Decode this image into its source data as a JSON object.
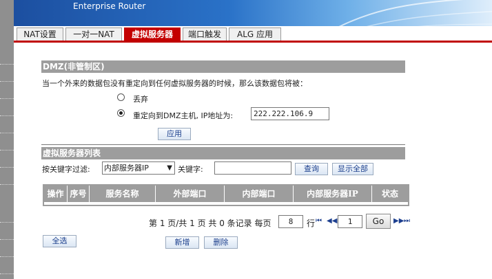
{
  "header": {
    "app_title": "Enterprise Router"
  },
  "tabs": [
    {
      "label": "NAT设置"
    },
    {
      "label": "一对一NAT"
    },
    {
      "label": "虚拟服务器"
    },
    {
      "label": "端口触发"
    },
    {
      "label": "ALG 应用"
    }
  ],
  "dmz": {
    "section_title": "DMZ(非管制区)",
    "description": "当一个外来的数据包没有重定向到任何虚拟服务器的时候，那么该数据包将被：",
    "option_drop": "丢弃",
    "option_redirect": "重定向到DMZ主机, IP地址为:",
    "ip_value": "222.222.106.9",
    "apply_label": "应用"
  },
  "vs_list": {
    "section_title": "虚拟服务器列表",
    "filter_label": "按关键字过滤:",
    "filter_select": "内部服务器IP",
    "keyword_label": "关键字:",
    "keyword_value": "",
    "query_label": "查询",
    "show_all_label": "显示全部",
    "columns": [
      "操作",
      "序号",
      "服务名称",
      "外部端口",
      "内部端口",
      "内部服务器IP",
      "状态"
    ]
  },
  "pager": {
    "summary": "第 1 页/共 1 页 共 0 条记录 每页",
    "per_page": "8",
    "row_label": "行",
    "page_input": "1",
    "go_label": "Go"
  },
  "actions": {
    "select_all": "全选",
    "add": "新增",
    "delete": "删除"
  }
}
